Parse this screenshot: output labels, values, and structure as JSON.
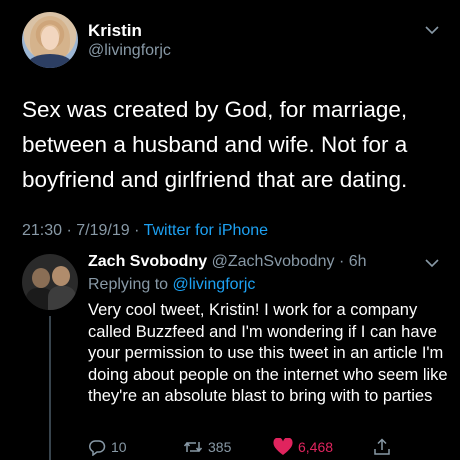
{
  "main_tweet": {
    "name": "Kristin",
    "handle": "@livingforjc",
    "text": "Sex was created by God, for marriage, between a husband and wife. Not for a boyfriend and girlfriend that are dating.",
    "time": "21:30 · 7/19/19 · ",
    "source": "Twitter for iPhone",
    "menu_icon": "chevron-down-icon"
  },
  "reply": {
    "name": "Zach Svobodny",
    "handle": "@ZachSvobodny",
    "time": " · 6h",
    "replying_label": "Replying to ",
    "replying_to": "@livingforjc",
    "text": "Very cool tweet, Kristin! I work for a company called Buzzfeed and I'm wondering if I can have your permission to use this tweet in an article I'm doing about people on the internet who seem like they're an absolute blast to bring with to parties",
    "actions": {
      "reply_count": "10",
      "retweet_count": "385",
      "like_count": "6,468"
    }
  },
  "colors": {
    "background": "#000000",
    "muted": "#8899a6",
    "link": "#1da1f2",
    "like": "#e0245e"
  }
}
